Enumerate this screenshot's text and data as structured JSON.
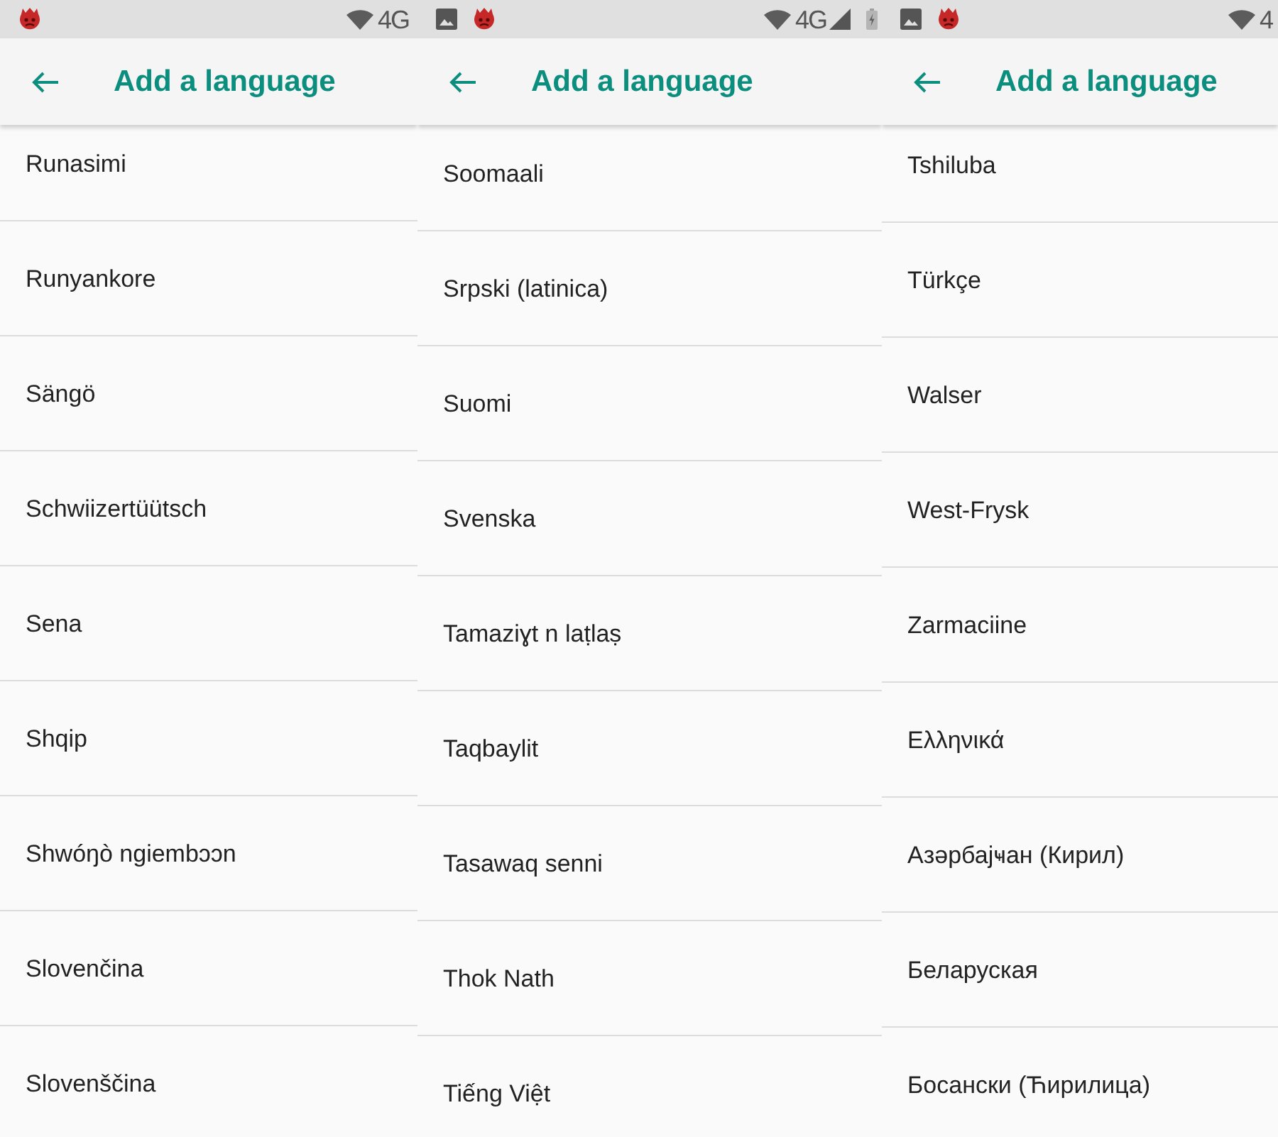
{
  "screens": [
    {
      "status_bar": {
        "left_icons": [
          {
            "kind": "app"
          }
        ],
        "right_icons": [
          {
            "kind": "wifi"
          },
          {
            "kind": "network",
            "text": "4G"
          }
        ]
      },
      "toolbar": {
        "title": "Add a language"
      },
      "languages": [
        "Runasimi",
        "Runyankore",
        "Sängö",
        "Schwiizertüütsch",
        "Sena",
        "Shqip",
        "Shwóŋò ngiembɔɔn",
        "Slovenčina",
        "Slovenščina"
      ]
    },
    {
      "status_bar": {
        "left_icons": [
          {
            "kind": "gallery"
          },
          {
            "kind": "app"
          }
        ],
        "right_icons": [
          {
            "kind": "wifi"
          },
          {
            "kind": "network",
            "text": "4G"
          },
          {
            "kind": "signal"
          },
          {
            "kind": "battery"
          }
        ]
      },
      "toolbar": {
        "title": "Add a language"
      },
      "languages": [
        "Soomaali",
        "Srpski (latinica)",
        "Suomi",
        "Svenska",
        "Tamaziɣt n laṭlaṣ",
        "Taqbaylit",
        "Tasawaq senni",
        "Thok Nath",
        "Tiếng Việt"
      ]
    },
    {
      "status_bar": {
        "left_icons": [
          {
            "kind": "gallery"
          },
          {
            "kind": "app"
          }
        ],
        "right_icons": [
          {
            "kind": "wifi"
          },
          {
            "kind": "network",
            "text": "4"
          }
        ]
      },
      "toolbar": {
        "title": "Add a language"
      },
      "languages": [
        "Tshiluba",
        "Türkçe",
        "Walser",
        "West-Frysk",
        "Zarmaciine",
        "Ελληνικά",
        "Азәрбајҹан (Кирил)",
        "Беларуская",
        "Босански (Ћирилица)"
      ]
    }
  ]
}
